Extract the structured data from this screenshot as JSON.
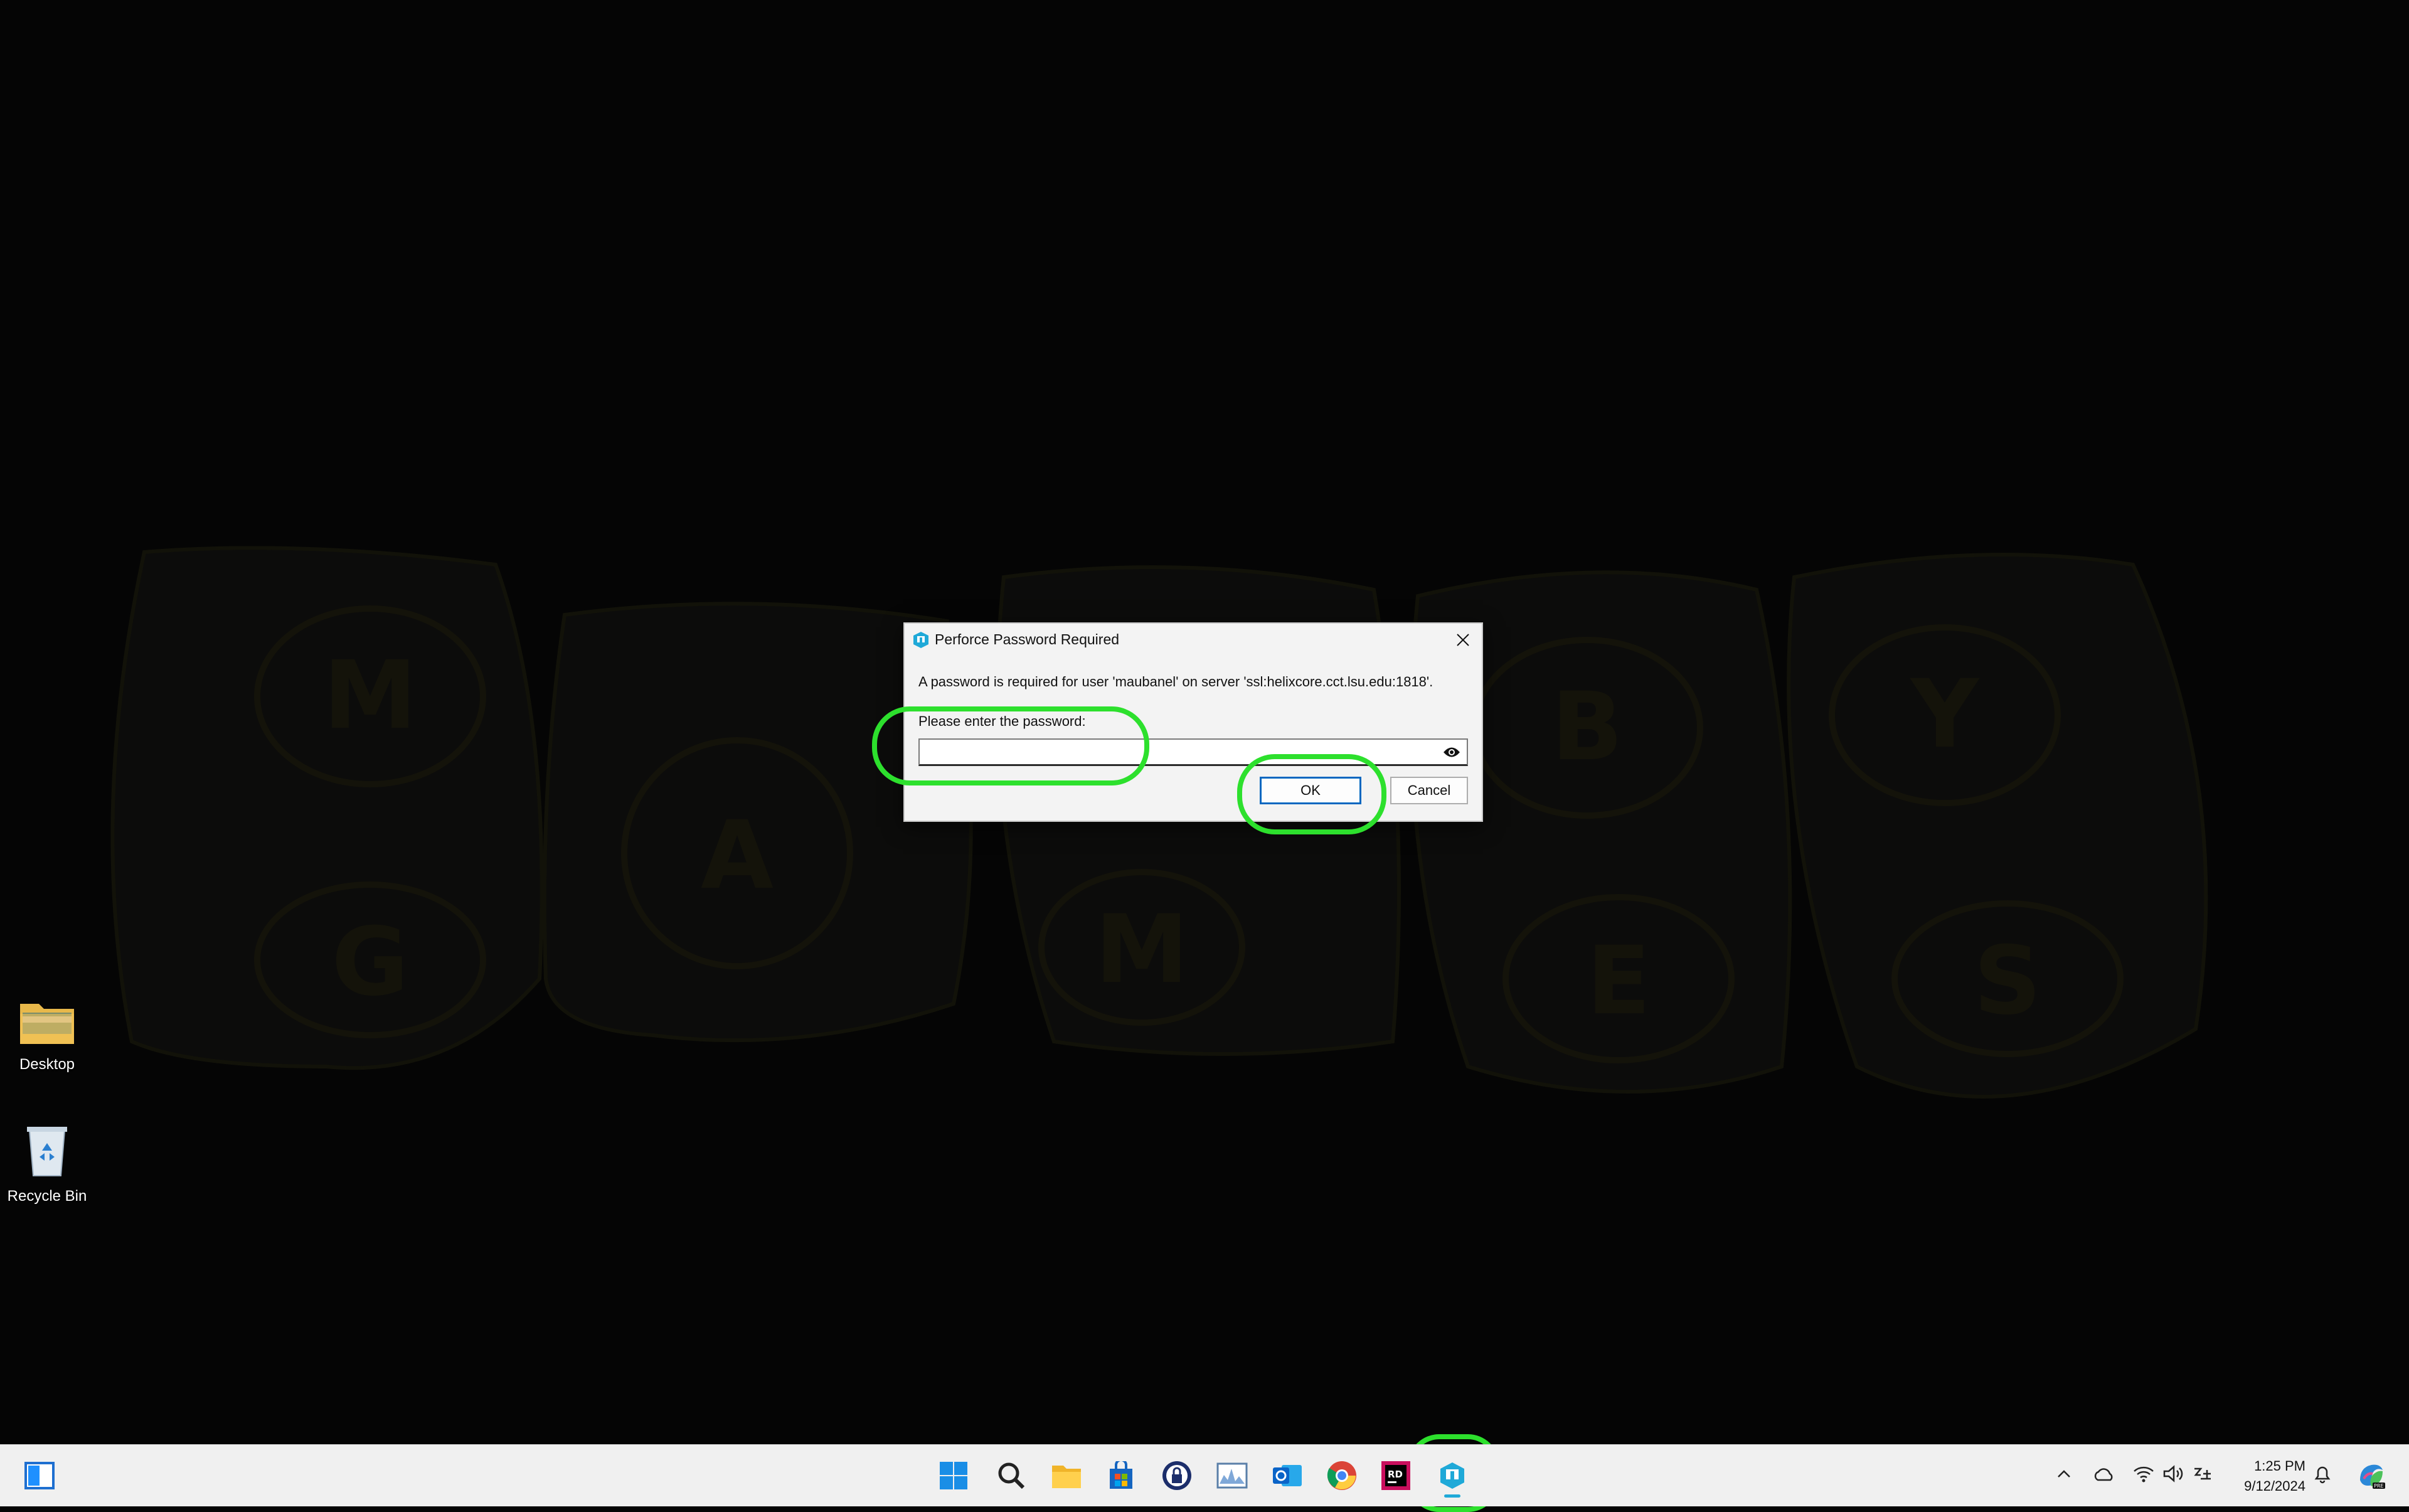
{
  "desktop": {
    "icons": [
      {
        "label": "Desktop",
        "icon": "folder-icon"
      },
      {
        "label": "Recycle Bin",
        "icon": "recycle-bin-icon"
      }
    ],
    "wallpaper_letters": [
      "M",
      "G",
      "A",
      "M",
      "B",
      "E",
      "Y",
      "S"
    ]
  },
  "dialog": {
    "title": "Perforce Password Required",
    "message": "A password is required for user 'maubanel' on server 'ssl:helixcore.cct.lsu.edu:1818'.",
    "prompt": "Please enter the password:",
    "password_value": "",
    "ok_label": "OK",
    "cancel_label": "Cancel"
  },
  "taskbar": {
    "apps": [
      "widgets-icon",
      "start-icon",
      "search-icon",
      "file-explorer-icon",
      "store-icon",
      "password-manager-icon",
      "performance-monitor-icon",
      "outlook-icon",
      "chrome-icon",
      "rider-icon",
      "perforce-icon"
    ],
    "time": "1:25 PM",
    "date": "9/12/2024"
  },
  "colors": {
    "highlight": "#2de02d",
    "accent": "#0067c0",
    "perforce": "#1fa9d8"
  }
}
